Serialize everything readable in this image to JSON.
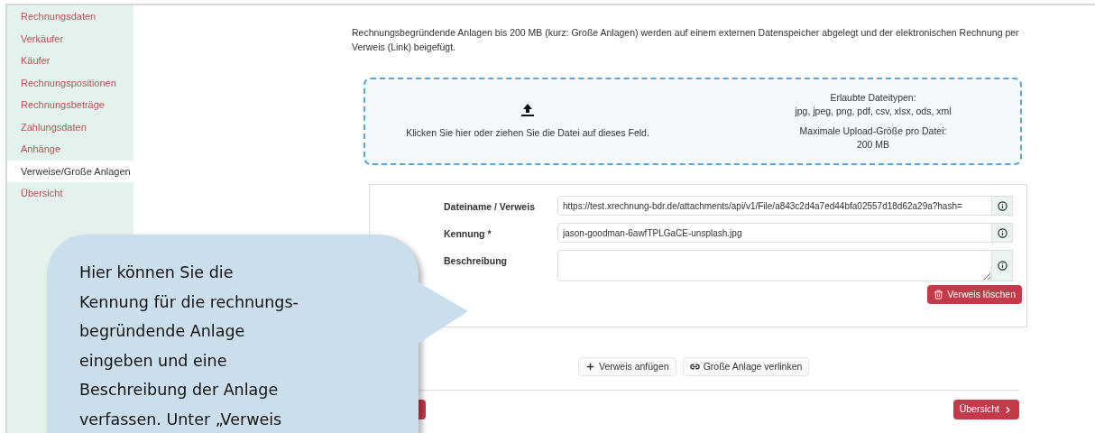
{
  "sidebar": {
    "items": [
      {
        "label": "Rechnungsdaten",
        "selected": false
      },
      {
        "label": "Verkäufer",
        "selected": false
      },
      {
        "label": "Käufer",
        "selected": false
      },
      {
        "label": "Rechnungspositionen",
        "selected": false
      },
      {
        "label": "Rechnungsbeträge",
        "selected": false
      },
      {
        "label": "Zahlungsdaten",
        "selected": false
      },
      {
        "label": "Anhänge",
        "selected": false
      },
      {
        "label": "Verweise/Große Anlagen",
        "selected": true
      },
      {
        "label": "Übersicht",
        "selected": false
      }
    ]
  },
  "intro": "Rechnungsbegründende Anlagen bis 200 MB (kurz: Große Anlagen) werden auf einem externen Datenspeicher abgelegt und der elektronischen Rechnung per Verweis (Link) beigefügt.",
  "dropzone": {
    "instruction": "Klicken Sie hier oder ziehen Sie die Datei auf dieses Feld.",
    "types_label": "Erlaubte Dateitypen:",
    "types": "jpg, jpeg, png, pdf, csv, xlsx, ods, xml",
    "size_label": "Maximale Upload-Größe pro Datei:",
    "size": "200 MB"
  },
  "form": {
    "fields": [
      {
        "kind": "input",
        "label": "Dateiname / Verweis",
        "value": "https://test.xrechnung-bdr.de/attachments/api/v1/File/a843c2d4a7ed44bfa02557d18d62a29a?hash="
      },
      {
        "kind": "input",
        "label": "Kennung *",
        "value": "jason-goodman-6awfTPLGaCE-unsplash.jpg"
      },
      {
        "kind": "textarea",
        "label": "Beschreibung"
      }
    ],
    "delete_button": "Verweis löschen"
  },
  "actions": [
    "Verweis anfügen",
    "Große Anlage verlinken"
  ],
  "next_button": "Übersicht",
  "callout": "Hier können Sie die\nKennung für die rechnungs-\nbegründende Anlage\neingeben und eine\nBeschreibung der Anlage\nverfassen. Unter „Verweis"
}
